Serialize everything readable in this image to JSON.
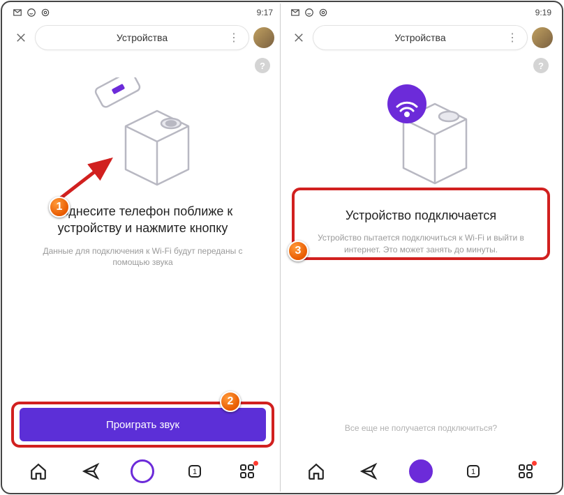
{
  "statusbar": {
    "time_left": "9:17",
    "time_right": "9:19"
  },
  "header": {
    "title": "Устройства"
  },
  "screen1": {
    "heading": "Поднесите телефон поближе к устройству и нажмите кнопку",
    "subtext": "Данные для подключения к Wi-Fi будут переданы с помощью звука",
    "button_label": "Проиграть звук"
  },
  "screen2": {
    "heading": "Устройство подключается",
    "subtext": "Устройство пытается подключиться к Wi-Fi и выйти в интернет. Это может занять до минуты.",
    "footer_link": "Все еще не получается подключиться?"
  },
  "callouts": {
    "n1": "1",
    "n2": "2",
    "n3": "3"
  }
}
